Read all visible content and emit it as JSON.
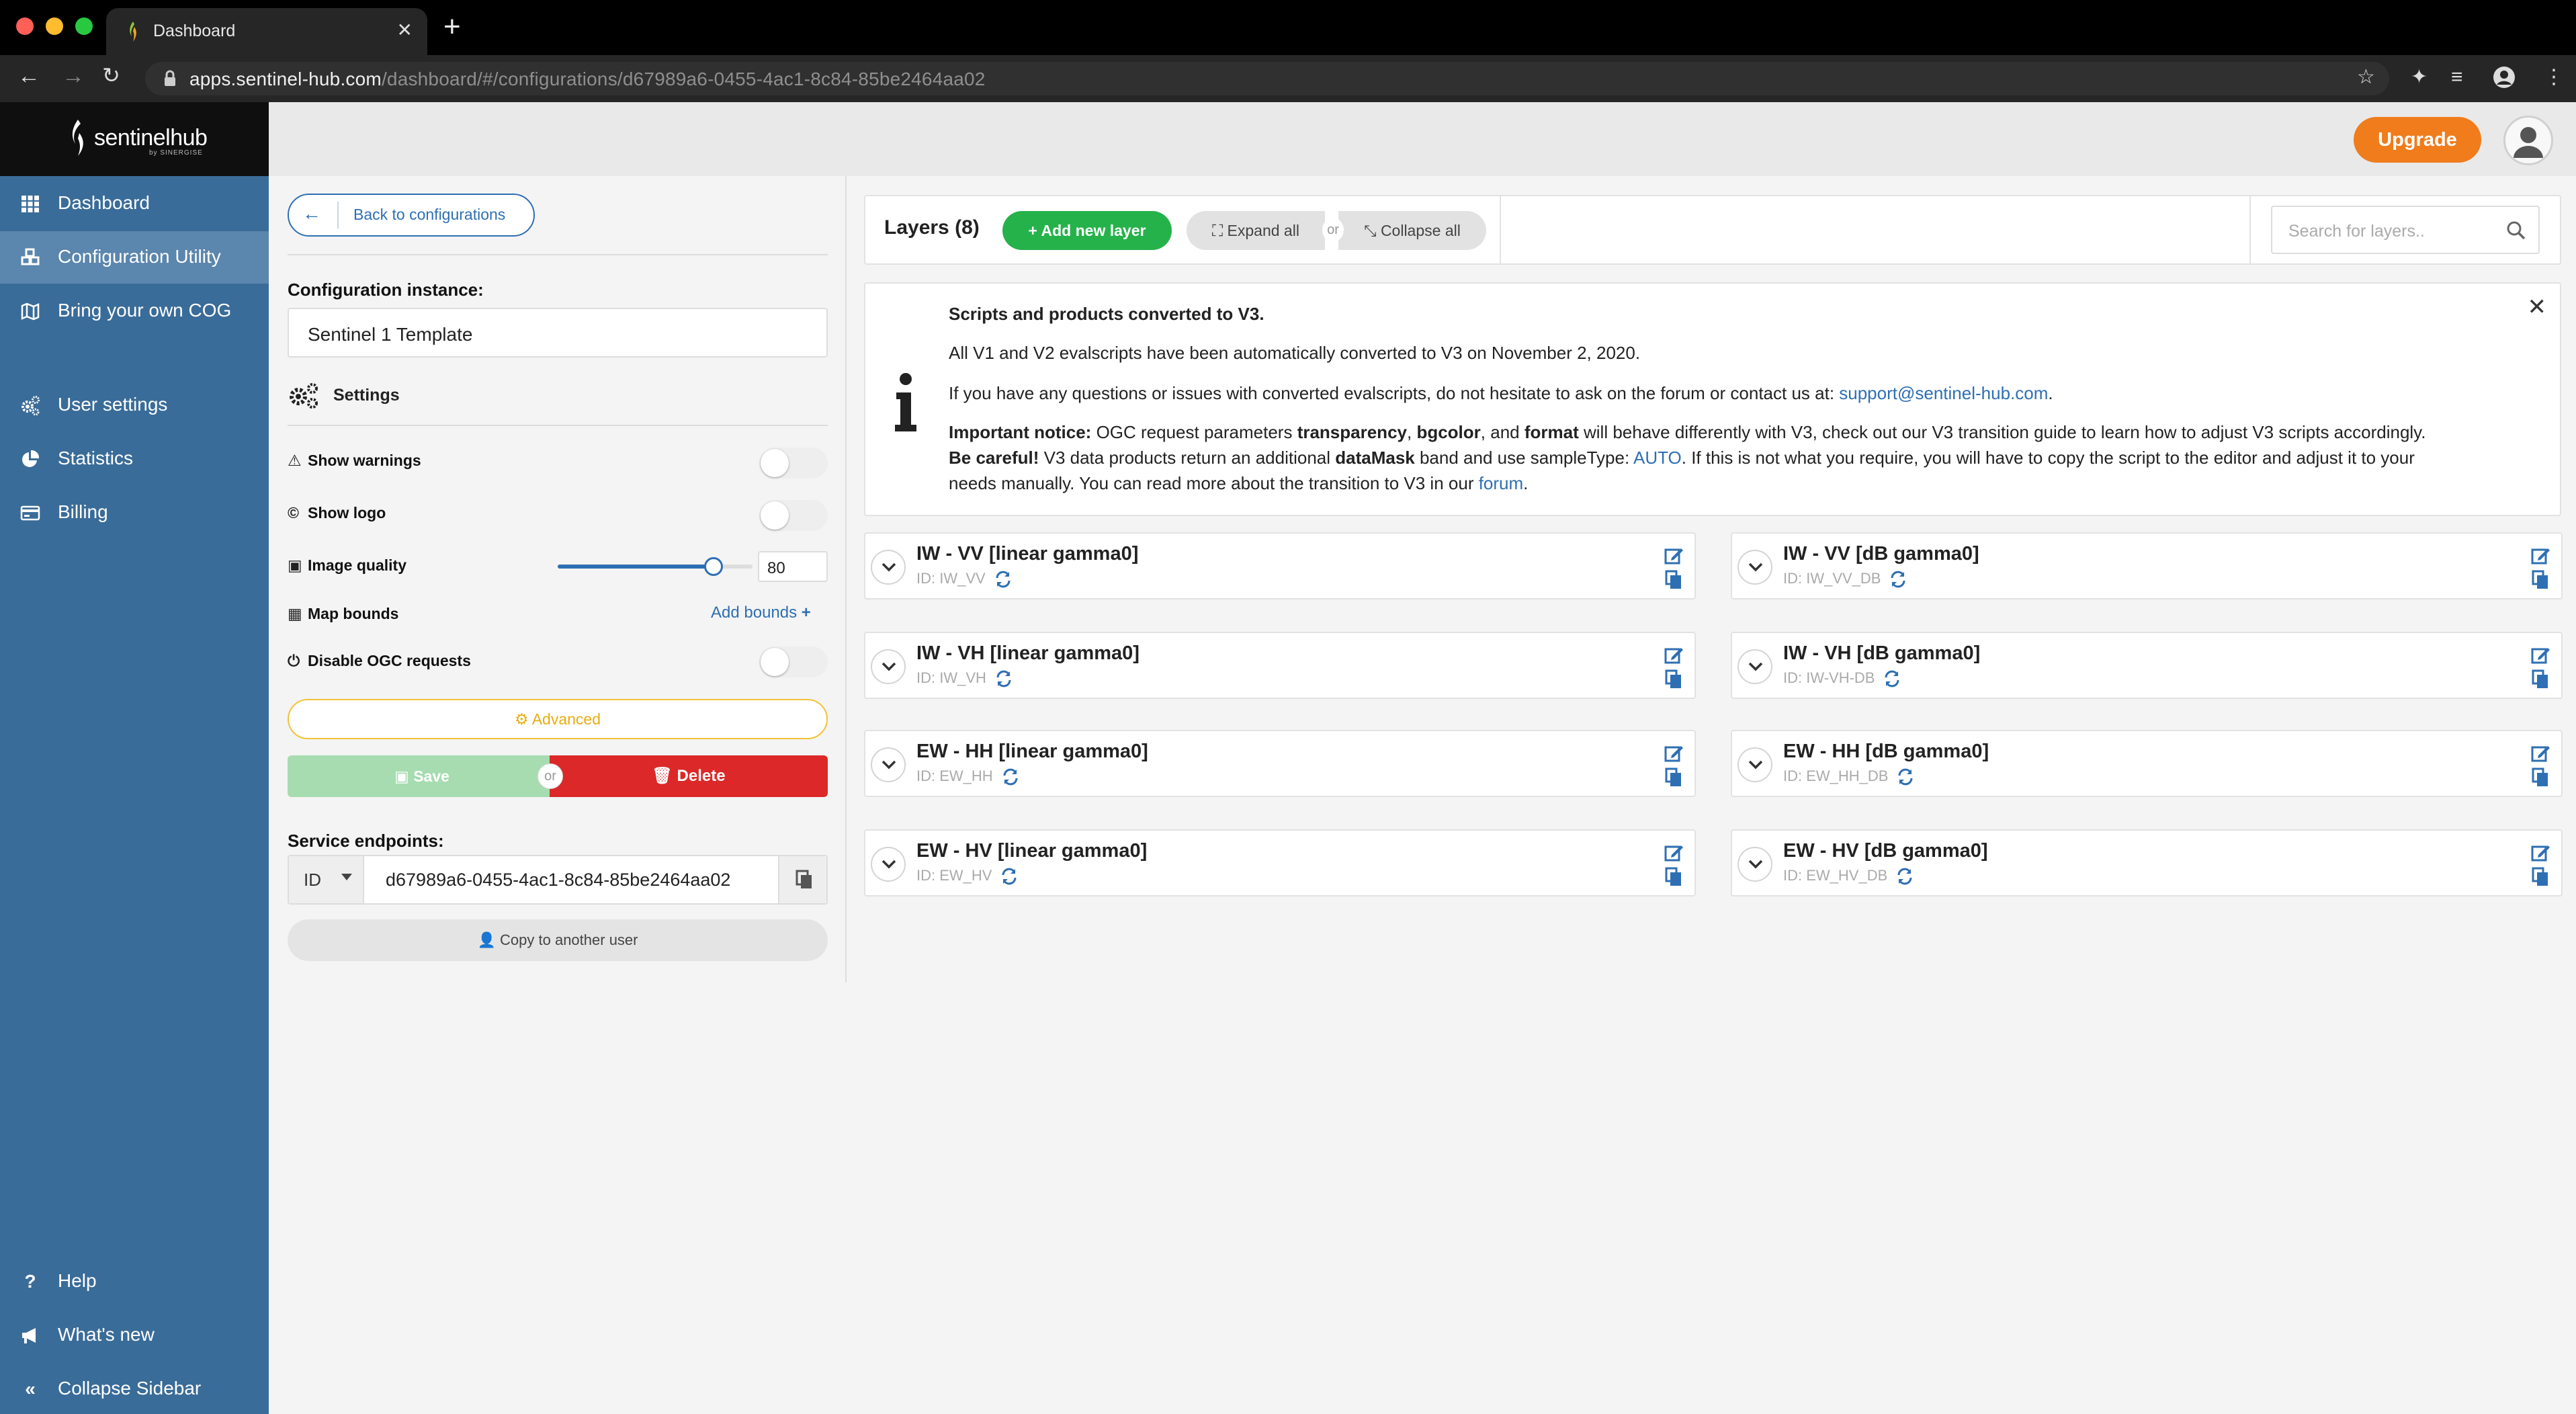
{
  "browser": {
    "tab_title": "Dashboard",
    "url_domain": "apps.sentinel-hub.com",
    "url_path": "/dashboard/#/configurations/d67989a6-0455-4ac1-8c84-85be2464aa02"
  },
  "brand": {
    "name": "sentinelhub",
    "sub": "by SINERGISE"
  },
  "sidebar": {
    "items": [
      {
        "label": "Dashboard",
        "icon": "grid-icon"
      },
      {
        "label": "Configuration Utility",
        "icon": "cubes-icon"
      },
      {
        "label": "Bring your own COG",
        "icon": "map-icon"
      },
      {
        "label": "User settings",
        "icon": "cogs-icon"
      },
      {
        "label": "Statistics",
        "icon": "pie-chart-icon"
      },
      {
        "label": "Billing",
        "icon": "credit-card-icon"
      }
    ],
    "bottom": [
      {
        "label": "Help",
        "icon": "question-icon"
      },
      {
        "label": "What's new",
        "icon": "megaphone-icon"
      },
      {
        "label": "Collapse Sidebar",
        "icon": "double-chevron-left-icon"
      }
    ]
  },
  "header": {
    "upgrade_label": "Upgrade"
  },
  "config": {
    "back_label": "Back to configurations",
    "instance_label": "Configuration instance:",
    "instance_value": "Sentinel 1 Template",
    "settings_label": "Settings",
    "show_warnings": "Show warnings",
    "show_logo": "Show logo",
    "image_quality": "Image quality",
    "image_quality_value": "80",
    "map_bounds": "Map bounds",
    "add_bounds": "Add bounds",
    "disable_ogc": "Disable OGC requests",
    "advanced": "Advanced",
    "save": "Save",
    "or": "or",
    "delete": "Delete",
    "endpoints_label": "Service endpoints:",
    "endpoint_type": "ID",
    "endpoint_id": "d67989a6-0455-4ac1-8c84-85be2464aa02",
    "copy_user": "Copy to another user"
  },
  "layers": {
    "title": "Layers (8)",
    "add_new": "Add new layer",
    "expand_all": "Expand all",
    "or": "or",
    "collapse_all": "Collapse all",
    "search_placeholder": "Search for layers..",
    "items": [
      {
        "title": "IW - VV [linear gamma0]",
        "id": "ID: IW_VV"
      },
      {
        "title": "IW - VV [dB gamma0]",
        "id": "ID: IW_VV_DB"
      },
      {
        "title": "IW - VH [linear gamma0]",
        "id": "ID: IW_VH"
      },
      {
        "title": "IW - VH [dB gamma0]",
        "id": "ID: IW-VH-DB"
      },
      {
        "title": "EW - HH [linear gamma0]",
        "id": "ID: EW_HH"
      },
      {
        "title": "EW - HH [dB gamma0]",
        "id": "ID: EW_HH_DB"
      },
      {
        "title": "EW - HV [linear gamma0]",
        "id": "ID: EW_HV"
      },
      {
        "title": "EW - HV [dB gamma0]",
        "id": "ID: EW_HV_DB"
      }
    ]
  },
  "notice": {
    "title": "Scripts and products converted to V3.",
    "line1": "All V1 and V2 evalscripts have been automatically converted to V3 on November 2, 2020.",
    "line2_pre": "If you have any questions or issues with converted evalscripts, do not hesitate to ask on the forum or contact us at: ",
    "line2_link": "support@sentinel-hub.com",
    "line2_post": ".",
    "line3_b1": "Important notice:",
    "line3_t1": " OGC request parameters ",
    "line3_b2": "transparency",
    "line3_t2": ", ",
    "line3_b3": "bgcolor",
    "line3_t3": ", and ",
    "line3_b4": "format",
    "line3_t4": " will behave differently with V3, check out our V3 transition guide to learn how to adjust V3 scripts accordingly.",
    "line4_b1": "Be careful!",
    "line4_t1": " V3 data products return an additional ",
    "line4_b2": "dataMask",
    "line4_t2": " band and use sampleType: ",
    "line4_link": "AUTO",
    "line4_t3": ". If this is not what you require, you will have to copy the script to the editor and adjust it to your",
    "line5_t1": "needs manually. You can read more about the transition to V3 in our ",
    "line5_link": "forum",
    "line5_t2": "."
  },
  "colors": {
    "sidebar": "#3a6c99",
    "sidebar_active": "#5b86ad",
    "primary": "#2e6fb3",
    "upgrade": "#f07c1c",
    "add_layer": "#26b24b",
    "delete": "#dc2828",
    "save_disabled": "#a6dcb0",
    "advanced": "#f3c236"
  }
}
